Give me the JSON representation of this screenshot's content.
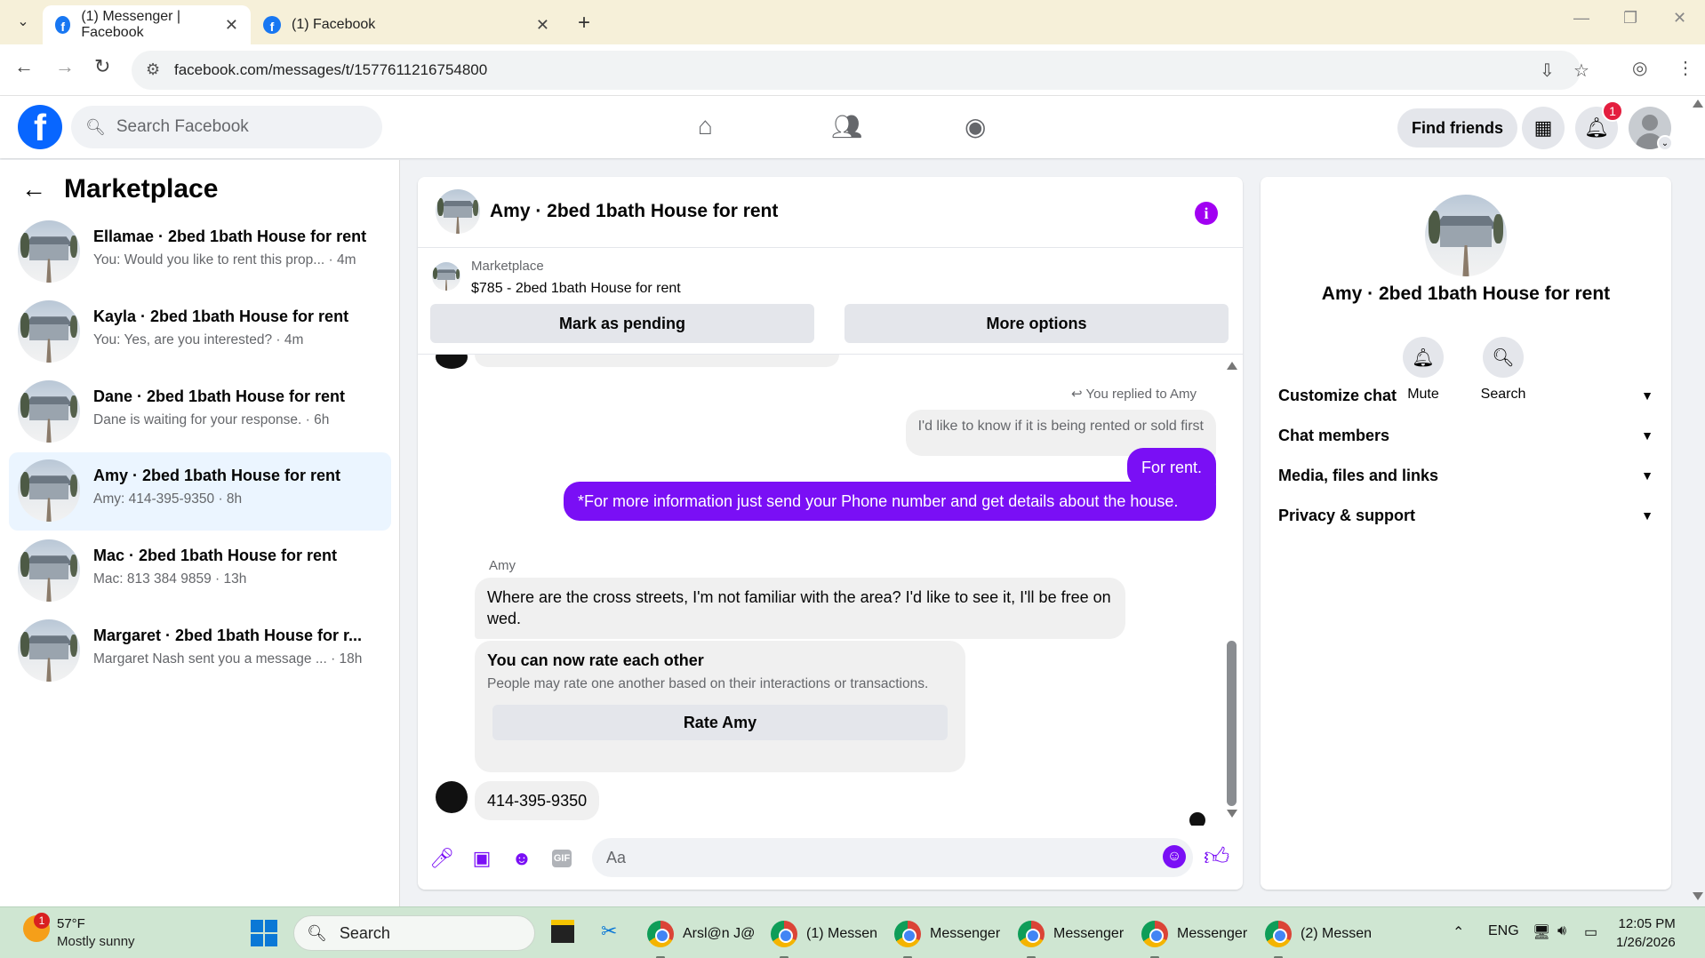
{
  "browser": {
    "tabs": [
      {
        "title": "(1) Messenger | Facebook",
        "active": true
      },
      {
        "title": "(1) Facebook",
        "active": false
      }
    ],
    "url": "facebook.com/messages/t/1577611216754800"
  },
  "fb_header": {
    "search_placeholder": "Search Facebook",
    "find_friends": "Find friends",
    "notification_count": "1"
  },
  "sidebar": {
    "title": "Marketplace",
    "conversations": [
      {
        "name": "Ellamae · 2bed 1bath House for rent",
        "snippet": "You: Would you like to rent this prop... · 4m",
        "selected": false
      },
      {
        "name": "Kayla · 2bed 1bath House for rent",
        "snippet": "You: Yes, are you interested? · 4m",
        "selected": false
      },
      {
        "name": "Dane · 2bed 1bath House for rent",
        "snippet": "Dane is waiting for your response. · 6h",
        "selected": false
      },
      {
        "name": "Amy · 2bed 1bath House for rent",
        "snippet": "Amy: 414-395-9350 · 8h",
        "selected": true
      },
      {
        "name": "Mac · 2bed 1bath House for rent",
        "snippet": "Mac: 813 384 9859 · 13h",
        "selected": false
      },
      {
        "name": "Margaret · 2bed 1bath House for r...",
        "snippet": "Margaret Nash sent you a message ... · 18h",
        "selected": false
      }
    ]
  },
  "chat": {
    "title": "Amy · 2bed 1bath House for rent",
    "listing_label": "Marketplace",
    "listing_price": "$785 - 2bed 1bath House for rent",
    "mark_pending": "Mark as pending",
    "more_options": "More options",
    "replied_note": "You replied to Amy",
    "quoted_text": "I'd like to know if it is being rented or sold first",
    "out_msg_1": "For rent.",
    "out_msg_2": "*For more information just send your Phone number and  get details about the house.",
    "sender_name": "Amy",
    "in_msg_1": "Where are the cross streets, I'm not familiar with the area? I'd like to see it, I'll be free on wed.",
    "rate_title": "You can now rate each other",
    "rate_desc": "People may rate one another based on their interactions or transactions.",
    "rate_button": "Rate Amy",
    "in_msg_2": "414-395-9350",
    "input_placeholder": "Aa",
    "accent_color": "#7a0ff5"
  },
  "details": {
    "name": "Amy · 2bed 1bath House for rent",
    "mute": "Mute",
    "search": "Search",
    "sections": [
      "Customize chat",
      "Chat members",
      "Media, files and links",
      "Privacy & support"
    ]
  },
  "taskbar": {
    "weather_temp": "57°F",
    "weather_desc": "Mostly sunny",
    "weather_badge": "1",
    "search": "Search",
    "apps": [
      "Arsl@n J@",
      "(1) Messen",
      "Messenger",
      "Messenger",
      "Messenger",
      "(2) Messen"
    ],
    "language": "ENG",
    "time": "12:05 PM",
    "date": "1/26/2026"
  }
}
